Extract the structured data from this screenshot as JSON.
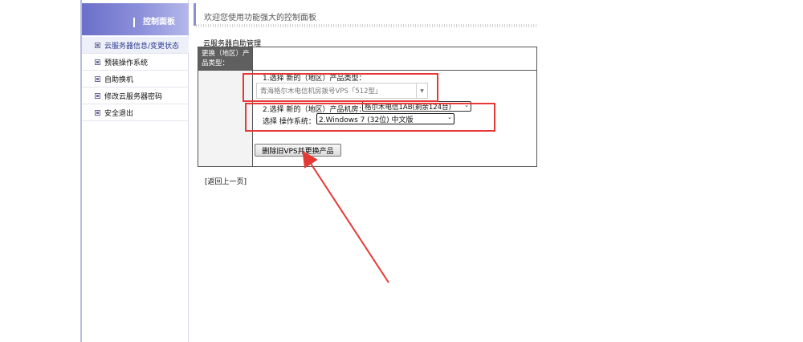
{
  "sidebar": {
    "title": "控制面板",
    "items": [
      {
        "label": "云服务器信息/变更状态"
      },
      {
        "label": "预装操作系统"
      },
      {
        "label": "自助换机"
      },
      {
        "label": "修改云服务器密码"
      },
      {
        "label": "安全退出"
      }
    ]
  },
  "header": {
    "welcome": "欢迎您使用功能强大的控制面板"
  },
  "section": {
    "label": "云服务器自助管理"
  },
  "form": {
    "row_label": "更换（地区）产品类型：",
    "step1_label": "1.选择 新的（地区）产品类型：",
    "product_type_value": "青海格尔木电信机房拨号VPS「512型」",
    "step2_label": "2.选择 新的（地区）产品机房：",
    "room_value": "格尔木电信1AB(剩余124台)",
    "os_label": "选择 操作系统：",
    "os_value": "2.Windows 7 (32位) 中文版",
    "submit_label": "删除旧VPS并更换产品"
  },
  "back_link": "[返回上一页]",
  "annotation": {
    "color": "#e53935"
  }
}
